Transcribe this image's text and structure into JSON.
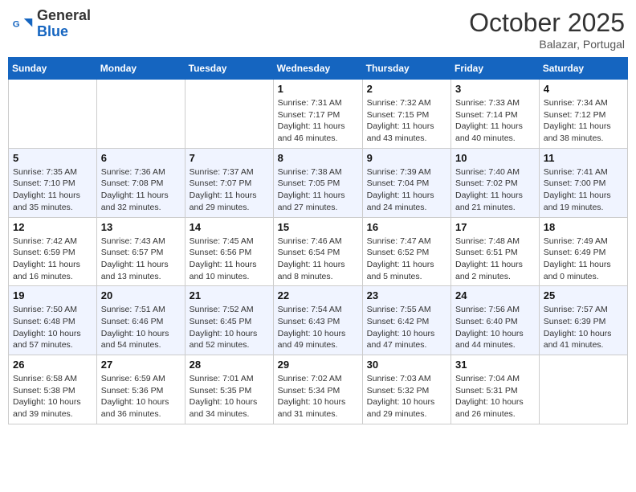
{
  "header": {
    "logo_line1": "General",
    "logo_line2": "Blue",
    "month": "October 2025",
    "location": "Balazar, Portugal"
  },
  "days_of_week": [
    "Sunday",
    "Monday",
    "Tuesday",
    "Wednesday",
    "Thursday",
    "Friday",
    "Saturday"
  ],
  "weeks": [
    [
      {
        "day": "",
        "info": ""
      },
      {
        "day": "",
        "info": ""
      },
      {
        "day": "",
        "info": ""
      },
      {
        "day": "1",
        "info": "Sunrise: 7:31 AM\nSunset: 7:17 PM\nDaylight: 11 hours and 46 minutes."
      },
      {
        "day": "2",
        "info": "Sunrise: 7:32 AM\nSunset: 7:15 PM\nDaylight: 11 hours and 43 minutes."
      },
      {
        "day": "3",
        "info": "Sunrise: 7:33 AM\nSunset: 7:14 PM\nDaylight: 11 hours and 40 minutes."
      },
      {
        "day": "4",
        "info": "Sunrise: 7:34 AM\nSunset: 7:12 PM\nDaylight: 11 hours and 38 minutes."
      }
    ],
    [
      {
        "day": "5",
        "info": "Sunrise: 7:35 AM\nSunset: 7:10 PM\nDaylight: 11 hours and 35 minutes."
      },
      {
        "day": "6",
        "info": "Sunrise: 7:36 AM\nSunset: 7:08 PM\nDaylight: 11 hours and 32 minutes."
      },
      {
        "day": "7",
        "info": "Sunrise: 7:37 AM\nSunset: 7:07 PM\nDaylight: 11 hours and 29 minutes."
      },
      {
        "day": "8",
        "info": "Sunrise: 7:38 AM\nSunset: 7:05 PM\nDaylight: 11 hours and 27 minutes."
      },
      {
        "day": "9",
        "info": "Sunrise: 7:39 AM\nSunset: 7:04 PM\nDaylight: 11 hours and 24 minutes."
      },
      {
        "day": "10",
        "info": "Sunrise: 7:40 AM\nSunset: 7:02 PM\nDaylight: 11 hours and 21 minutes."
      },
      {
        "day": "11",
        "info": "Sunrise: 7:41 AM\nSunset: 7:00 PM\nDaylight: 11 hours and 19 minutes."
      }
    ],
    [
      {
        "day": "12",
        "info": "Sunrise: 7:42 AM\nSunset: 6:59 PM\nDaylight: 11 hours and 16 minutes."
      },
      {
        "day": "13",
        "info": "Sunrise: 7:43 AM\nSunset: 6:57 PM\nDaylight: 11 hours and 13 minutes."
      },
      {
        "day": "14",
        "info": "Sunrise: 7:45 AM\nSunset: 6:56 PM\nDaylight: 11 hours and 10 minutes."
      },
      {
        "day": "15",
        "info": "Sunrise: 7:46 AM\nSunset: 6:54 PM\nDaylight: 11 hours and 8 minutes."
      },
      {
        "day": "16",
        "info": "Sunrise: 7:47 AM\nSunset: 6:52 PM\nDaylight: 11 hours and 5 minutes."
      },
      {
        "day": "17",
        "info": "Sunrise: 7:48 AM\nSunset: 6:51 PM\nDaylight: 11 hours and 2 minutes."
      },
      {
        "day": "18",
        "info": "Sunrise: 7:49 AM\nSunset: 6:49 PM\nDaylight: 11 hours and 0 minutes."
      }
    ],
    [
      {
        "day": "19",
        "info": "Sunrise: 7:50 AM\nSunset: 6:48 PM\nDaylight: 10 hours and 57 minutes."
      },
      {
        "day": "20",
        "info": "Sunrise: 7:51 AM\nSunset: 6:46 PM\nDaylight: 10 hours and 54 minutes."
      },
      {
        "day": "21",
        "info": "Sunrise: 7:52 AM\nSunset: 6:45 PM\nDaylight: 10 hours and 52 minutes."
      },
      {
        "day": "22",
        "info": "Sunrise: 7:54 AM\nSunset: 6:43 PM\nDaylight: 10 hours and 49 minutes."
      },
      {
        "day": "23",
        "info": "Sunrise: 7:55 AM\nSunset: 6:42 PM\nDaylight: 10 hours and 47 minutes."
      },
      {
        "day": "24",
        "info": "Sunrise: 7:56 AM\nSunset: 6:40 PM\nDaylight: 10 hours and 44 minutes."
      },
      {
        "day": "25",
        "info": "Sunrise: 7:57 AM\nSunset: 6:39 PM\nDaylight: 10 hours and 41 minutes."
      }
    ],
    [
      {
        "day": "26",
        "info": "Sunrise: 6:58 AM\nSunset: 5:38 PM\nDaylight: 10 hours and 39 minutes."
      },
      {
        "day": "27",
        "info": "Sunrise: 6:59 AM\nSunset: 5:36 PM\nDaylight: 10 hours and 36 minutes."
      },
      {
        "day": "28",
        "info": "Sunrise: 7:01 AM\nSunset: 5:35 PM\nDaylight: 10 hours and 34 minutes."
      },
      {
        "day": "29",
        "info": "Sunrise: 7:02 AM\nSunset: 5:34 PM\nDaylight: 10 hours and 31 minutes."
      },
      {
        "day": "30",
        "info": "Sunrise: 7:03 AM\nSunset: 5:32 PM\nDaylight: 10 hours and 29 minutes."
      },
      {
        "day": "31",
        "info": "Sunrise: 7:04 AM\nSunset: 5:31 PM\nDaylight: 10 hours and 26 minutes."
      },
      {
        "day": "",
        "info": ""
      }
    ]
  ]
}
